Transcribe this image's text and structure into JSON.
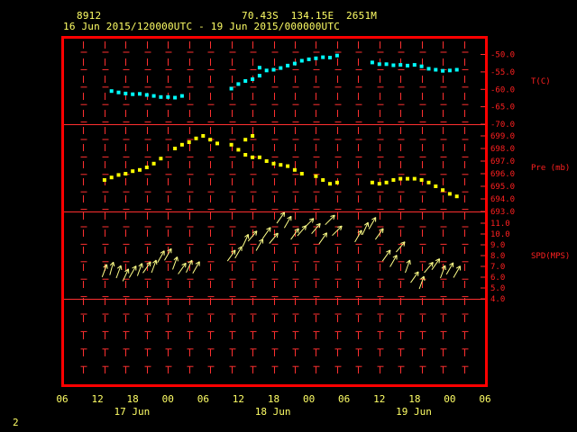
{
  "header": {
    "station_id": "8912",
    "location": "70.43S  134.15E  2651M",
    "period": "16 Jun 2015/120000UTC - 19 Jun 2015/000000UTC"
  },
  "page_number": "2",
  "colors": {
    "frame": "#ff0000",
    "grid": "#ff3030",
    "label_red": "#ff2020",
    "label_yellow": "#ffff66",
    "temperature": "#00ffff",
    "pressure": "#ffff00",
    "wind": "#ffff88"
  },
  "chart_data": [
    {
      "type": "scatter",
      "panel": "temperature",
      "title": "T(C)",
      "yticks": [
        "-50.0",
        "-55.0",
        "-60.0",
        "-65.0",
        "-70.0"
      ],
      "ylim": [
        -70,
        -48
      ],
      "x_unit": "hours since 16 Jun 2015 06 UTC",
      "x": [
        14,
        16,
        18,
        20,
        22,
        24,
        26,
        28,
        30,
        32,
        34,
        48,
        50,
        52,
        54,
        56,
        58,
        60,
        62,
        64,
        66,
        68,
        70,
        72,
        74,
        76,
        78,
        88,
        90,
        92,
        94,
        96,
        98,
        100,
        102,
        104,
        106,
        108,
        110,
        112
      ],
      "values": [
        -60.5,
        -60.9,
        -61.2,
        -61.4,
        -61.3,
        -61.6,
        -61.9,
        -62.2,
        -62.2,
        -62.4,
        -61.9,
        -59.8,
        -58.5,
        -57.6,
        -57.1,
        -56.1,
        -54.6,
        -54.4,
        -53.9,
        -53.2,
        -52.6,
        -51.8,
        -51.4,
        -51.1,
        -50.8,
        -50.9,
        -50.3,
        -52.3,
        -52.8,
        -52.8,
        -53.1,
        -53.0,
        -53.2,
        -53.0,
        -53.4,
        -54.1,
        -54.4,
        -54.7,
        -54.6,
        -54.4
      ],
      "outliers": [
        {
          "x": 56,
          "y": -53.8
        }
      ]
    },
    {
      "type": "scatter",
      "panel": "pressure",
      "title": "Pre (mb)",
      "yticks": [
        "699.0",
        "698.0",
        "697.0",
        "696.0",
        "695.0",
        "694.0",
        "693.0"
      ],
      "ylim": [
        692.8,
        699.3
      ],
      "x": [
        12,
        14,
        16,
        18,
        20,
        22,
        24,
        26,
        28,
        32,
        34,
        36,
        38,
        40,
        42,
        44,
        48,
        50,
        52,
        54,
        56,
        58,
        60,
        62,
        64,
        66,
        68,
        72,
        74,
        76,
        78,
        88,
        90,
        92,
        94,
        96,
        98,
        100,
        102,
        104,
        106,
        108,
        110,
        112
      ],
      "values": [
        695.5,
        695.7,
        695.9,
        696.0,
        696.2,
        696.3,
        696.5,
        696.8,
        697.2,
        698.0,
        698.3,
        698.5,
        698.8,
        699.0,
        698.7,
        698.4,
        698.3,
        697.9,
        697.5,
        697.3,
        697.3,
        697.0,
        696.8,
        696.7,
        696.6,
        696.3,
        696.0,
        695.8,
        695.5,
        695.2,
        695.3,
        695.3,
        695.2,
        695.3,
        695.5,
        695.6,
        695.6,
        695.6,
        695.5,
        695.3,
        695.0,
        694.7,
        694.4,
        694.2
      ],
      "outliers": [
        {
          "x": 54,
          "y": 699.0
        },
        {
          "x": 52,
          "y": 698.7
        }
      ]
    },
    {
      "type": "scatter",
      "panel": "wind",
      "title": "SPD(MPS)",
      "yticks": [
        "11.0",
        "10.0",
        "9.0",
        "8.0",
        "7.0",
        "6.0",
        "5.0",
        "4.0"
      ],
      "ylim": [
        3.8,
        11.5
      ],
      "x": [
        12,
        14,
        16,
        18,
        20,
        22,
        24,
        26,
        28,
        30,
        32,
        34,
        36,
        38,
        48,
        50,
        52,
        54,
        56,
        58,
        60,
        62,
        64,
        66,
        68,
        70,
        72,
        74,
        76,
        78,
        84,
        86,
        88,
        90,
        92,
        94,
        96,
        98,
        100,
        102,
        104,
        106,
        108,
        110,
        112
      ],
      "values": [
        6.6,
        6.8,
        6.5,
        6.2,
        6.5,
        6.7,
        6.9,
        7.0,
        7.9,
        8.1,
        7.3,
        6.8,
        7.0,
        6.9,
        8.0,
        8.3,
        9.4,
        9.8,
        9.0,
        10.1,
        9.6,
        11.5,
        11.1,
        10.0,
        10.3,
        11.0,
        10.5,
        9.6,
        11.3,
        10.3,
        9.8,
        10.5,
        11.0,
        10.0,
        8.0,
        7.5,
        8.8,
        7.0,
        6.0,
        5.5,
        6.9,
        7.2,
        6.5,
        6.8,
        6.5
      ],
      "wind_from_deg": [
        200,
        195,
        200,
        205,
        210,
        200,
        215,
        200,
        210,
        210,
        200,
        215,
        205,
        210,
        215,
        210,
        205,
        220,
        210,
        215,
        220,
        215,
        210,
        215,
        220,
        225,
        220,
        215,
        225,
        225,
        210,
        205,
        210,
        215,
        215,
        210,
        220,
        200,
        215,
        200,
        220,
        215,
        200,
        210,
        210
      ]
    }
  ],
  "x_axis": {
    "tick_labels": [
      "06",
      "12",
      "18",
      "00",
      "06",
      "12",
      "18",
      "00",
      "06",
      "12",
      "18",
      "00",
      "06"
    ],
    "date_labels": [
      "17 Jun",
      "18 Jun",
      "19 Jun"
    ]
  }
}
